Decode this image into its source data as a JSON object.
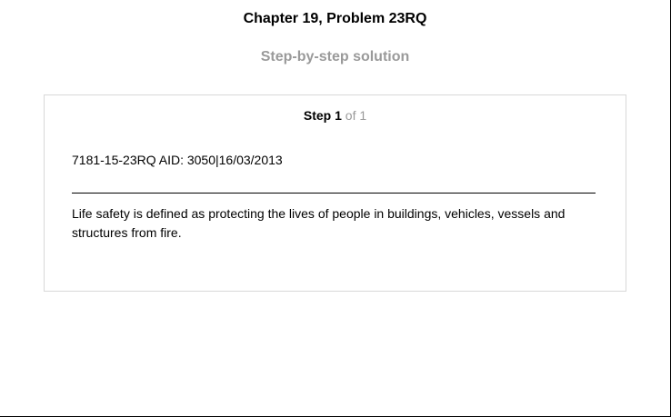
{
  "header": {
    "chapter_title": "Chapter 19, Problem 23RQ",
    "subtitle": "Step-by-step solution"
  },
  "step": {
    "label": "Step",
    "number": "1",
    "of_text": "of 1",
    "meta": "7181-15-23RQ AID: 3050|16/03/2013",
    "body": "Life safety is defined as protecting the lives of people in buildings, vehicles, vessels and structures from fire."
  },
  "colors": {
    "title": "#000000",
    "subtitle": "#9a9a9a",
    "card_border": "#d8d8d8",
    "muted": "#9a9a9a"
  }
}
